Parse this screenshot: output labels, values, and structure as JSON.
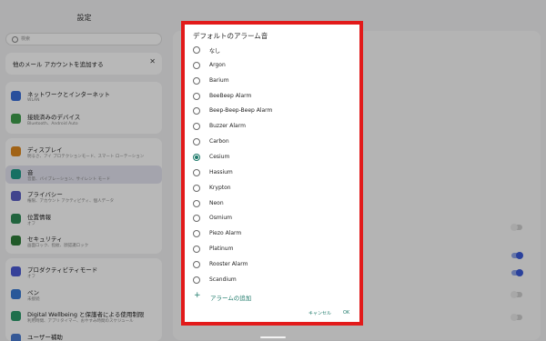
{
  "settings": {
    "title": "設定",
    "search_placeholder": "検索",
    "account_banner": "他のメール アカウントを追加する",
    "close_glyph": "✕",
    "group1": [
      {
        "name": "network",
        "title": "ネットワークとインターネット",
        "sub": "WLAN",
        "color": "#3b6fd8"
      },
      {
        "name": "devices",
        "title": "接続済みのデバイス",
        "sub": "Bluetooth、Android Auto",
        "color": "#3f9e4d"
      }
    ],
    "group2": [
      {
        "name": "display",
        "title": "ディスプレイ",
        "sub": "明るさ、アイ プロテクションモード、スマート ローテーション",
        "color": "#e08a1f"
      },
      {
        "name": "sound",
        "title": "音",
        "sub": "音量、バイブレーション、サイレント モード",
        "color": "#1f9b8a"
      },
      {
        "name": "privacy",
        "title": "プライバシー",
        "sub": "権限、アカウント アクティビティ、個人データ",
        "color": "#5a5fc4"
      },
      {
        "name": "location",
        "title": "位置情報",
        "sub": "オフ",
        "color": "#2e8b57"
      },
      {
        "name": "security",
        "title": "セキュリティ",
        "sub": "画面ロック、指紋、顔認識ロック",
        "color": "#2f7d3a"
      }
    ],
    "group3": [
      {
        "name": "productivity",
        "title": "プロダクティビティモード",
        "sub": "オフ",
        "color": "#4c5bd4"
      },
      {
        "name": "pen",
        "title": "ペン",
        "sub": "未接続",
        "color": "#3a7bd5"
      },
      {
        "name": "wellbeing",
        "title": "Digital Wellbeing と保護者による使用制限",
        "sub": "利用時間、アプリタイマー、おやすみ時間のスケジュール",
        "color": "#2b9a6a"
      },
      {
        "name": "users",
        "title": "ユーザー補助",
        "sub": "",
        "color": "#4a7ad0"
      }
    ]
  },
  "dialog": {
    "title": "デフォルトのアラーム音",
    "options": [
      "なし",
      "Argon",
      "Barium",
      "BeeBeep Alarm",
      "Beep-Beep-Beep Alarm",
      "Buzzer Alarm",
      "Carbon",
      "Cesium",
      "Hassium",
      "Krypton",
      "Neon",
      "Osmium",
      "Piezo Alarm",
      "Platinum",
      "Rooster Alarm",
      "Scandium"
    ],
    "selected": "Cesium",
    "add_label": "アラームの追加",
    "add_glyph": "+",
    "cancel_label": "キャンセル",
    "ok_label": "OK"
  },
  "colors": {
    "accent": "#1e7a6a",
    "highlight_border": "#e21a1a"
  }
}
